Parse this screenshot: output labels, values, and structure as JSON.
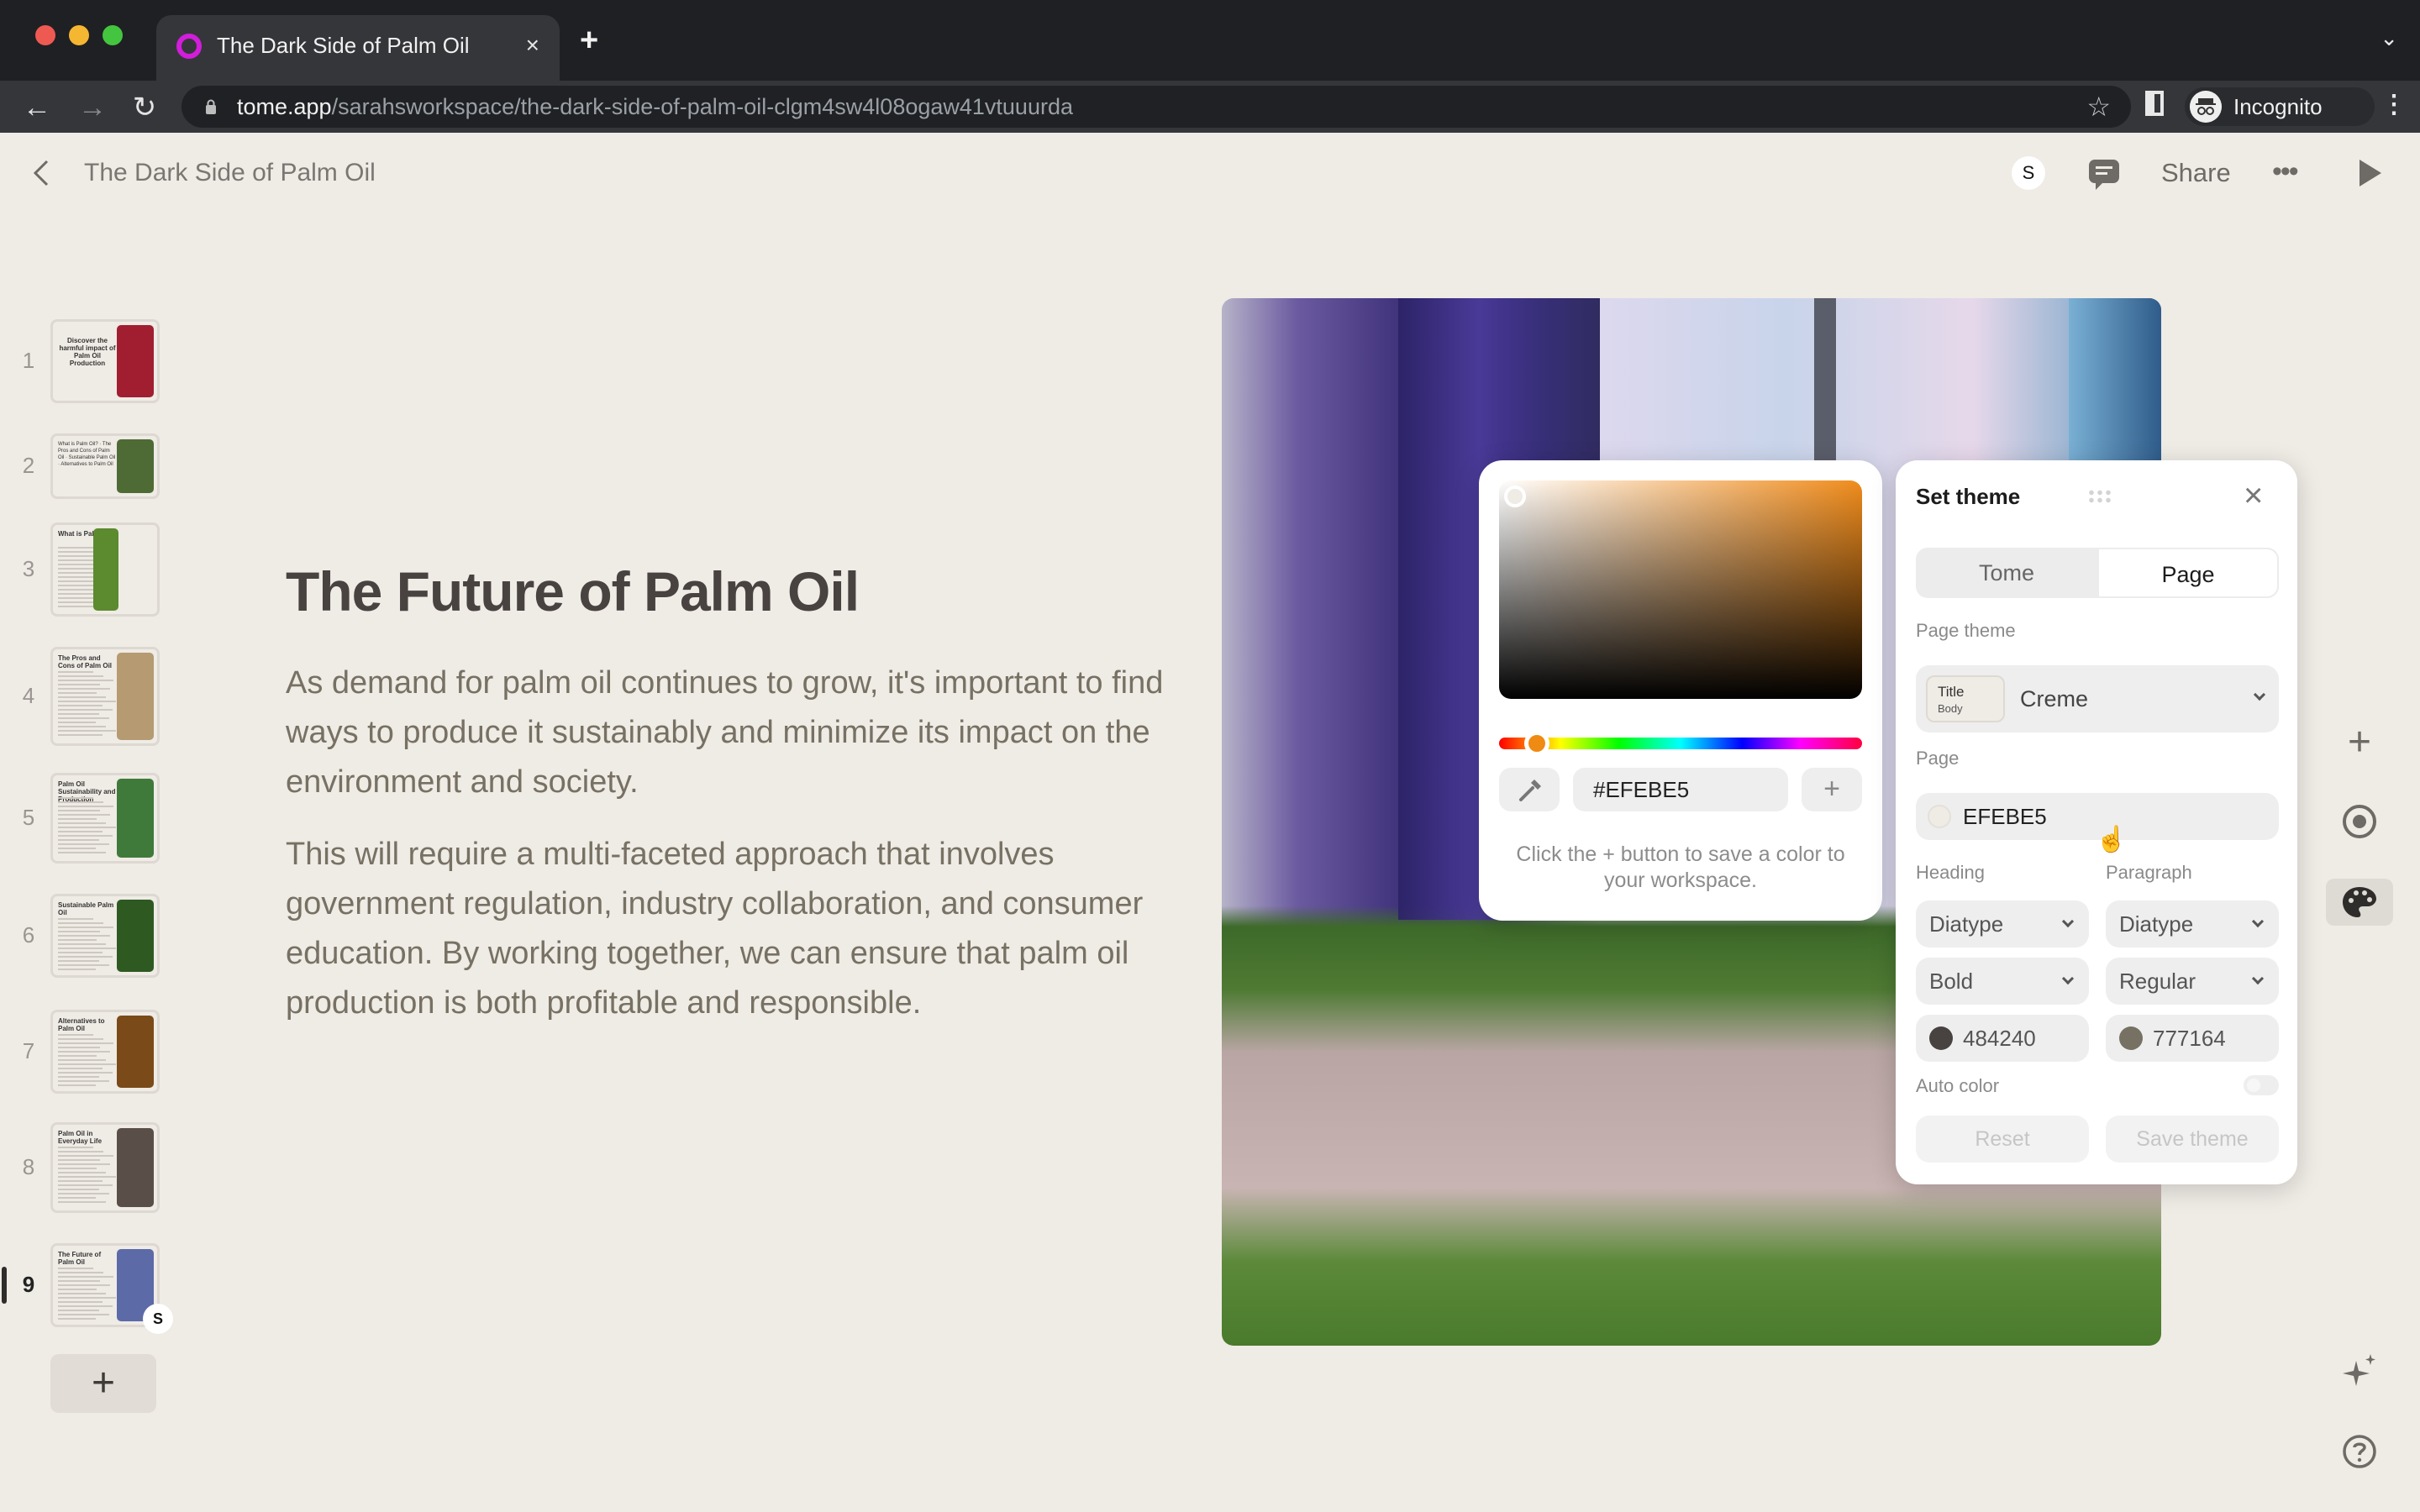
{
  "browser": {
    "tab_title": "The Dark Side of Palm Oil",
    "tab_close": "×",
    "new_tab": "+",
    "tab_list": "⌄",
    "url_host": "tome.app",
    "url_path": "/sarahsworkspace/the-dark-side-of-palm-oil-clgm4sw4l08ogaw41vtuuurda",
    "profile_label": "Incognito",
    "icons": {
      "back": "←",
      "forward": "→",
      "reload": "↻",
      "star": "☆",
      "menu": "⋮"
    }
  },
  "header": {
    "doc_title": "The Dark Side of Palm Oil",
    "avatar_initial": "S",
    "share_label": "Share",
    "more_label": "•••"
  },
  "sidebar": {
    "active_page": 9,
    "pages": [
      {
        "number": "1",
        "title": "Discover the harmful impact of Palm Oil Production",
        "image_color": "#a01e30"
      },
      {
        "number": "2",
        "title": "What is Palm Oil? · The Pros and Cons of Palm Oil · Sustainable Palm Oil · Alternatives to Palm Oil",
        "image_color": "#4e6b35"
      },
      {
        "number": "3",
        "title": "What is Palm Oil?",
        "image_color": "#5c8a2e"
      },
      {
        "number": "4",
        "title": "The Pros and Cons of Palm Oil",
        "image_color": "#b59a72"
      },
      {
        "number": "5",
        "title": "Palm Oil Sustainability and Production",
        "image_color": "#3f7a3a"
      },
      {
        "number": "6",
        "title": "Sustainable Palm Oil",
        "image_color": "#2e5a22"
      },
      {
        "number": "7",
        "title": "Alternatives to Palm Oil",
        "image_color": "#7a4a18"
      },
      {
        "number": "8",
        "title": "Palm Oil in Everyday Life",
        "image_color": "#5a4e48"
      },
      {
        "number": "9",
        "title": "The Future of Palm Oil",
        "image_color": "#5d6aa8"
      }
    ],
    "thumb_avatar": "S",
    "add_page_label": "+"
  },
  "slide": {
    "heading": "The Future of Palm Oil",
    "paragraphs": [
      "As demand for palm oil continues to grow, it's important to find ways to produce it sustainably and minimize its impact on the environment and society.",
      "This will require a multi-faceted approach that involves government regulation, industry collaboration, and consumer education. By working together, we can ensure that palm oil production is both profitable and responsible."
    ]
  },
  "color_picker": {
    "hex_value": "#EFEBE5",
    "hue_color": "#F08C1C",
    "add_label": "+",
    "hint": "Click the + button to save a color to your workspace."
  },
  "theme_panel": {
    "title": "Set theme",
    "close_label": "×",
    "tabs": [
      "Tome",
      "Page"
    ],
    "selected_tab": "Page",
    "page_theme_label": "Page theme",
    "theme_preview_title": "Title",
    "theme_preview_body": "Body",
    "theme_name": "Creme",
    "page_label": "Page",
    "page_color": "EFEBE5",
    "page_color_hex": "#EFEBE5",
    "heading_label": "Heading",
    "paragraph_label": "Paragraph",
    "heading_font": "Diatype",
    "paragraph_font": "Diatype",
    "heading_weight": "Bold",
    "paragraph_weight": "Regular",
    "heading_color": "484240",
    "heading_color_hex": "#484240",
    "paragraph_color": "777164",
    "paragraph_color_hex": "#777164",
    "auto_color_label": "Auto color",
    "auto_color_on": false,
    "reset_label": "Reset",
    "save_label": "Save theme"
  },
  "right_rail": {
    "add_label": "+",
    "icons": [
      "add-icon",
      "record-icon",
      "palette-icon",
      "sparkle-icon",
      "help-icon"
    ]
  }
}
